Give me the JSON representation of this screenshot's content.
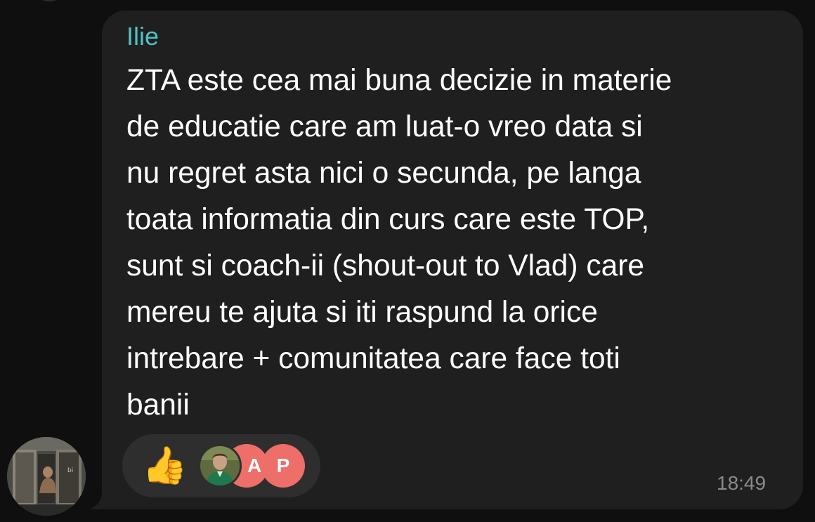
{
  "message": {
    "sender_name": "Ilie",
    "sender_color": "#4fc2c4",
    "text_lines": [
      "ZTA este cea mai buna decizie in materie",
      "de educatie care am luat-o vreo data si",
      "nu regret asta nici o secunda, pe langa",
      "toata informatia din curs care este TOP,",
      "sunt si coach-ii (shout-out to Vlad) care",
      "mereu te ajuta si iti raspund la orice",
      "intrebare + comunitatea care face toti",
      "banii"
    ],
    "time": "18:49"
  },
  "reaction": {
    "emoji": "👍",
    "avatars": [
      {
        "icon": "user-photo-avatar"
      },
      {
        "initial": "A",
        "color": "#ee6e6a"
      },
      {
        "initial": "P",
        "color": "#ee6e6a"
      }
    ]
  },
  "colors": {
    "background": "#0f0f0f",
    "bubble": "#1f1f1f",
    "reaction_pill": "#2e2e2e",
    "timestamp": "#8a8a8a"
  }
}
